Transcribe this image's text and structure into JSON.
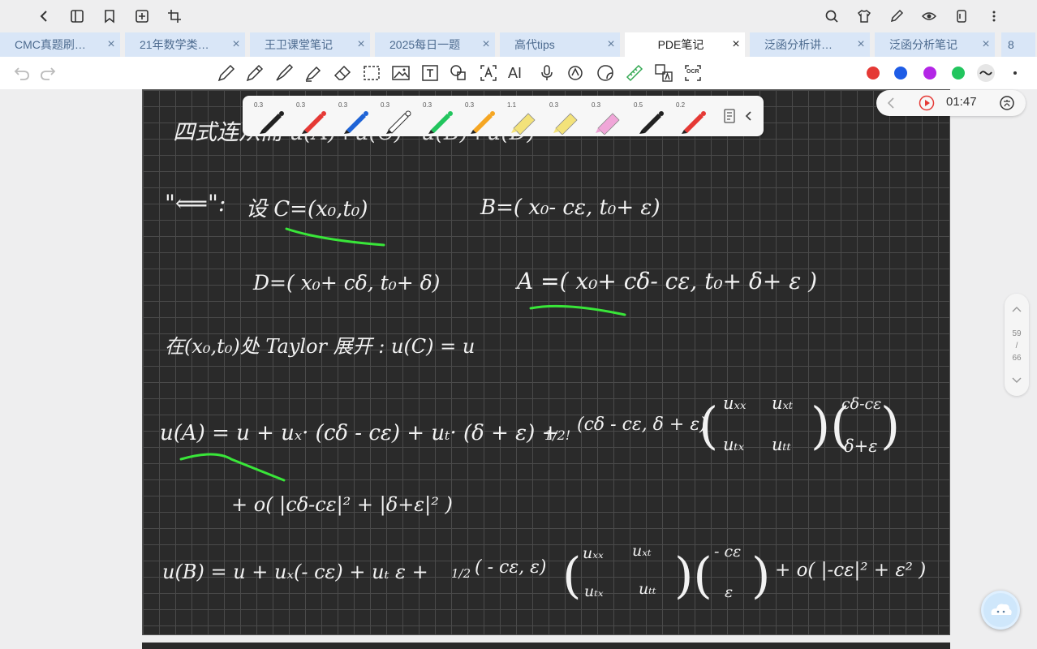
{
  "tabs": [
    {
      "label": "CMC真题刷…",
      "active": false
    },
    {
      "label": "21年数学类…",
      "active": false
    },
    {
      "label": "王卫课堂笔记",
      "active": false
    },
    {
      "label": "2025每日一题",
      "active": false
    },
    {
      "label": "高代tips",
      "active": false
    },
    {
      "label": "PDE笔记",
      "active": true
    },
    {
      "label": "泛函分析讲…",
      "active": false
    },
    {
      "label": "泛函分析笔记",
      "active": false
    }
  ],
  "tab_overflow": "8",
  "tab_close": "×",
  "pens": [
    {
      "width": "0.3",
      "color": "#111111",
      "icon": "pen-icon"
    },
    {
      "width": "0.3",
      "color": "#e53935",
      "icon": "pen-icon"
    },
    {
      "width": "0.3",
      "color": "#1e63d6",
      "icon": "pen-icon"
    },
    {
      "width": "0.3",
      "color": "#ffffff",
      "icon": "pen-icon"
    },
    {
      "width": "0.3",
      "color": "#22c55e",
      "icon": "pen-icon"
    },
    {
      "width": "0.3",
      "color": "#f5a623",
      "icon": "pen-icon"
    },
    {
      "width": "1.1",
      "color": "#f3e27a",
      "icon": "highlighter-icon"
    },
    {
      "width": "0.3",
      "color": "#f3e27a",
      "icon": "highlighter-icon"
    },
    {
      "width": "0.3",
      "color": "#f0a6d8",
      "icon": "highlighter-icon"
    },
    {
      "width": "0.5",
      "color": "#111111",
      "icon": "pen-icon"
    },
    {
      "width": "0.2",
      "color": "#e53935",
      "icon": "pen-icon"
    }
  ],
  "palette": [
    "#e53935",
    "#1e5ce6",
    "#b326e6",
    "#22c55e"
  ],
  "recording": {
    "time": "01:47"
  },
  "pager": {
    "current": "59",
    "sep": "/",
    "total": "66"
  },
  "toolbar": {
    "ocr_label": "OCR",
    "ai_label": "AI"
  },
  "note": {
    "line1": "四式连从而 u(A)+u(C)=u(B)+u(D)",
    "l2a": "\"⟸\":",
    "l2b": "设 C=(x₀,t₀)",
    "l2c": "B=( x₀- cε, t₀+ ε)",
    "l3a": "D=( x₀+ cδ, t₀+ δ)",
    "l3b": "A =( x₀+ cδ- cε, t₀+ δ+ ε )",
    "l4": "在(x₀,t₀)处 Taylor 展开 :   u(C) = u",
    "l5a": "u(A) = u + uₓ· (cδ - cε) + uₜ· (δ + ε) + ",
    "half": "1/2!",
    "l5b": "(cδ - cε, δ + ε)",
    "mA": [
      "uₓₓ",
      "uₓₜ",
      "uₜₓ",
      "uₜₜ"
    ],
    "vA": [
      "cδ-cε",
      "δ+ε"
    ],
    "l6": "+ o( |cδ-cε|² + |δ+ε|² )",
    "l7a": "u(B) = u + uₓ(- cε) + uₜ ε + ",
    "half2": "1/2",
    "l7b": "( - cε, ε)",
    "mB": [
      "uₓₓ",
      "uₓₜ",
      "uₜₓ",
      "uₜₜ"
    ],
    "vB": [
      "- cε",
      "ε"
    ],
    "l7c": "+ o( |-cε|² + ε² )"
  }
}
